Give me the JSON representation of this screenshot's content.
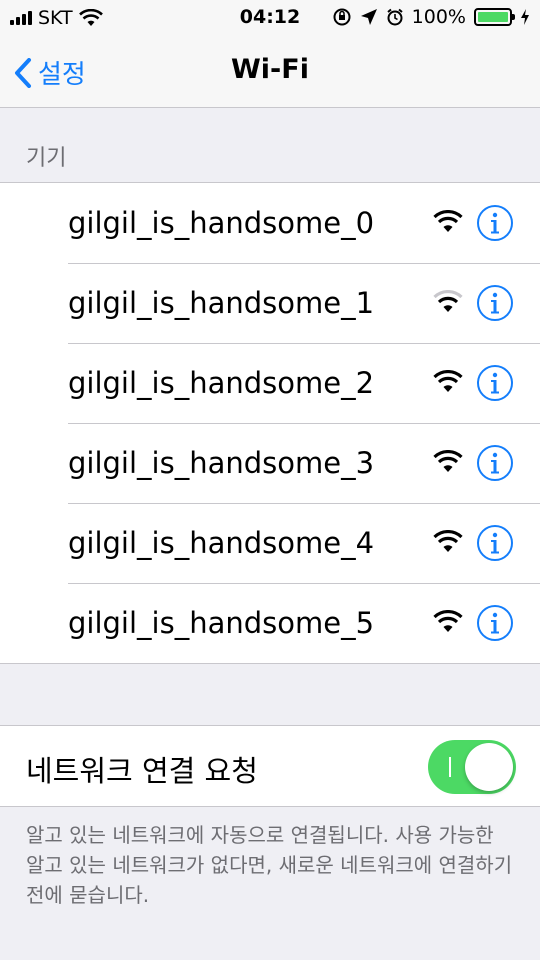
{
  "status_bar": {
    "carrier": "SKT",
    "time": "04:12",
    "battery_percent": "100%",
    "battery_level": 1.0
  },
  "nav": {
    "back_label": "설정",
    "title": "Wi-Fi"
  },
  "section": {
    "header": "기기"
  },
  "networks": [
    {
      "name": "gilgil_is_handsome_0",
      "signal": "full"
    },
    {
      "name": "gilgil_is_handsome_1",
      "signal": "weak"
    },
    {
      "name": "gilgil_is_handsome_2",
      "signal": "full"
    },
    {
      "name": "gilgil_is_handsome_3",
      "signal": "full"
    },
    {
      "name": "gilgil_is_handsome_4",
      "signal": "full"
    },
    {
      "name": "gilgil_is_handsome_5",
      "signal": "full"
    }
  ],
  "ask_to_join": {
    "label": "네트워크 연결 요청",
    "enabled": true
  },
  "footer": {
    "text": "알고 있는 네트워크에 자동으로 연결됩니다. 사용 가능한 알고 있는 네트워크가 없다면, 새로운 네트워크에 연결하기 전에 묻습니다."
  },
  "colors": {
    "accent": "#147efb",
    "toggle_on": "#4cd964",
    "background": "#efeff4"
  },
  "icons": {
    "back": "chevron-left-icon",
    "wifi": "wifi-icon",
    "info": "info-icon"
  }
}
